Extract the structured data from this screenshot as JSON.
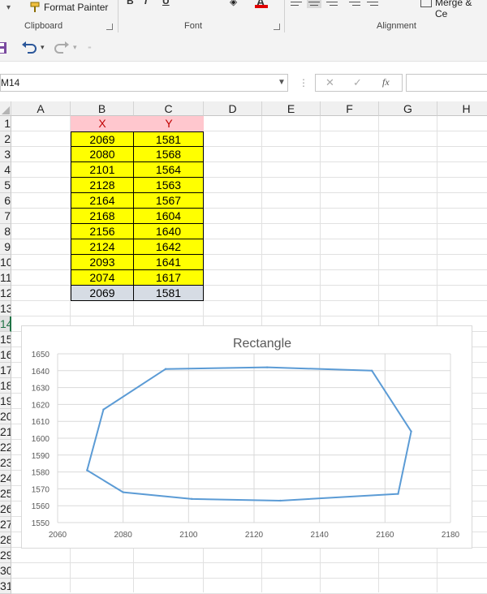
{
  "ribbon": {
    "format_painter": "Format Painter",
    "merge_label": "Merge & Ce",
    "groups": {
      "clipboard": "Clipboard",
      "font": "Font",
      "alignment": "Alignment"
    },
    "font_buttons": [
      "B",
      "I",
      "U"
    ]
  },
  "formula_bar": {
    "name_box": "M14",
    "formula": "",
    "cancel_glyph": "✕",
    "enter_glyph": "✓",
    "fx_glyph": "fx"
  },
  "columns": [
    "A",
    "B",
    "C",
    "D",
    "E",
    "F",
    "G",
    "H"
  ],
  "rows": [
    "1",
    "2",
    "3",
    "4",
    "5",
    "6",
    "7",
    "8",
    "9",
    "10",
    "11",
    "12",
    "13",
    "14",
    "15",
    "16",
    "17",
    "18",
    "19",
    "20",
    "21",
    "22",
    "23",
    "24",
    "25",
    "26",
    "27",
    "28",
    "29",
    "30",
    "31"
  ],
  "selected_row": "14",
  "table": {
    "header": {
      "x": "X",
      "y": "Y"
    },
    "rows": [
      {
        "x": "2069",
        "y": "1581"
      },
      {
        "x": "2080",
        "y": "1568"
      },
      {
        "x": "2101",
        "y": "1564"
      },
      {
        "x": "2128",
        "y": "1563"
      },
      {
        "x": "2164",
        "y": "1567"
      },
      {
        "x": "2168",
        "y": "1604"
      },
      {
        "x": "2156",
        "y": "1640"
      },
      {
        "x": "2124",
        "y": "1642"
      },
      {
        "x": "2093",
        "y": "1641"
      },
      {
        "x": "2074",
        "y": "1617"
      }
    ],
    "closing_row": {
      "x": "2069",
      "y": "1581"
    }
  },
  "colors": {
    "header_fill": "#ffc7ce",
    "header_text": "#c00000",
    "data_fill": "#ffff00",
    "closing_fill": "#d6dce4",
    "series_line": "#5b9bd5",
    "accent_green": "#217346"
  },
  "icons": [
    "format-painter-icon",
    "save-icon",
    "undo-icon",
    "redo-icon",
    "dropdown-arrow-icon",
    "dialog-launcher-icon"
  ],
  "chart_data": {
    "type": "scatter",
    "title": "Rectangle",
    "xlabel": "",
    "ylabel": "",
    "xlim": [
      2060,
      2180
    ],
    "ylim": [
      1550,
      1650
    ],
    "xticks": [
      2060,
      2080,
      2100,
      2120,
      2140,
      2160,
      2180
    ],
    "yticks": [
      1550,
      1560,
      1570,
      1580,
      1590,
      1600,
      1610,
      1620,
      1630,
      1640,
      1650
    ],
    "grid": true,
    "legend": "none",
    "series": [
      {
        "x": [
          2069,
          2080,
          2101,
          2128,
          2164,
          2168,
          2156,
          2124,
          2093,
          2074,
          2069
        ],
        "y": [
          1581,
          1568,
          1564,
          1563,
          1567,
          1604,
          1640,
          1642,
          1641,
          1617,
          1581
        ]
      }
    ]
  }
}
